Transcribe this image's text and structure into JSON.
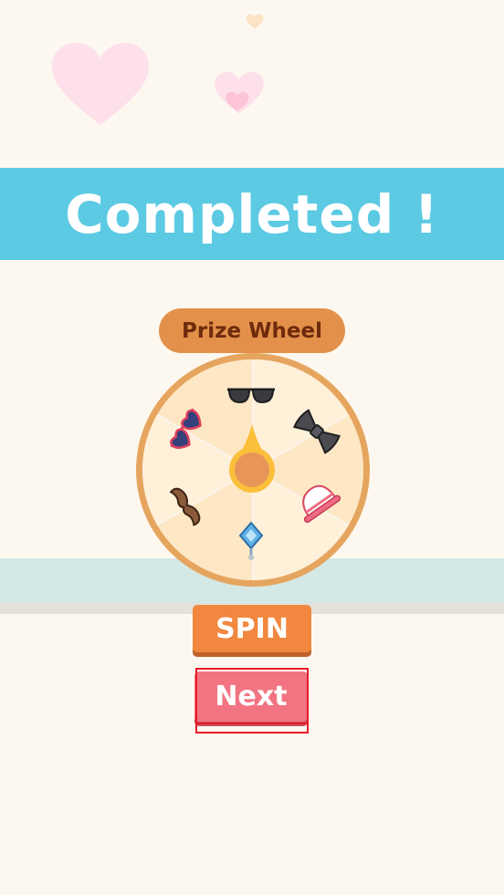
{
  "header": {
    "title": "Completed !"
  },
  "wheel": {
    "title": "Prize Wheel",
    "segments": [
      {
        "icon": "sunglasses-icon"
      },
      {
        "icon": "bow-tie-icon"
      },
      {
        "icon": "hat-icon"
      },
      {
        "icon": "pendant-icon"
      },
      {
        "icon": "mustache-icon"
      },
      {
        "icon": "heart-sunglasses-icon"
      }
    ]
  },
  "buttons": {
    "spin": "SPIN",
    "next": "Next"
  },
  "colors": {
    "banner": "#5ccae3",
    "wheel_rim": "#e6a55e",
    "spin_button": "#f2883f",
    "next_button": "#f27482",
    "highlight": "#e81a2a"
  }
}
